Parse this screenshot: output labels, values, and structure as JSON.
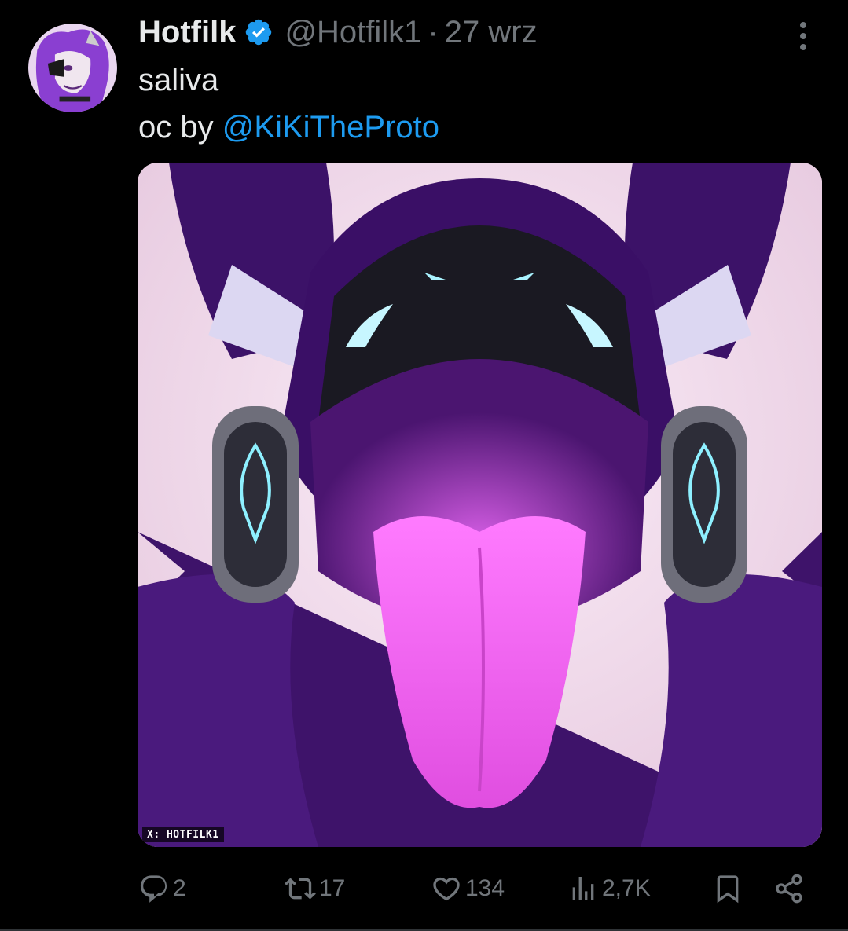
{
  "tweet": {
    "author_name": "Hotfilk",
    "handle": "@Hotfilk1",
    "separator": "·",
    "date": "27 wrz",
    "text_line1": "saliva",
    "text_line2_prefix": "oc by ",
    "mention": "@KiKiTheProto",
    "media_watermark": "X: HOTFILK1"
  },
  "actions": {
    "replies": "2",
    "reposts": "17",
    "likes": "134",
    "views": "2,7K"
  },
  "icons": {
    "verified": "verified-badge-icon",
    "more": "more-options-icon",
    "reply": "reply-icon",
    "repost": "repost-icon",
    "like": "heart-icon",
    "views": "views-icon",
    "bookmark": "bookmark-icon",
    "share": "share-icon"
  },
  "colors": {
    "background": "#000000",
    "primary_text": "#e7e9ea",
    "secondary_text": "#71767b",
    "link": "#1d9bf0"
  }
}
